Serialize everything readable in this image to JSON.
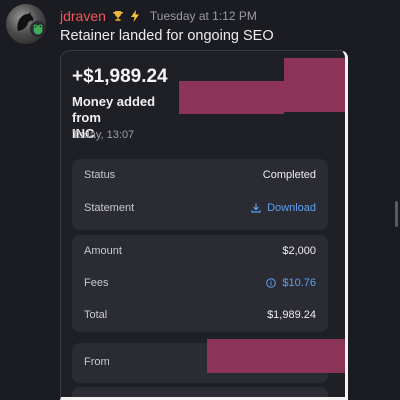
{
  "message": {
    "username": "jdraven",
    "timestamp": "Tuesday at 1:12 PM",
    "text": "Retainer landed for ongoing SEO",
    "badges": [
      "trophy-icon",
      "lightning-icon"
    ]
  },
  "transaction": {
    "amount": "+$1,989.24",
    "title": "Money added from",
    "title_line2": "INC",
    "date": "Today, 13:07"
  },
  "status_panel": {
    "status_label": "Status",
    "status_value": "Completed",
    "statement_label": "Statement",
    "download_label": "Download"
  },
  "amount_panel": {
    "amount_label": "Amount",
    "amount_value": "$2,000",
    "fees_label": "Fees",
    "fees_value": "$10.76",
    "total_label": "Total",
    "total_value": "$1,989.24"
  },
  "from_panel": {
    "from_label": "From"
  },
  "colors": {
    "username": "#f2555b",
    "link": "#5f9ff0",
    "redaction": "#8c3457",
    "panel": "#2b2c33",
    "background": "#1b1c21"
  }
}
